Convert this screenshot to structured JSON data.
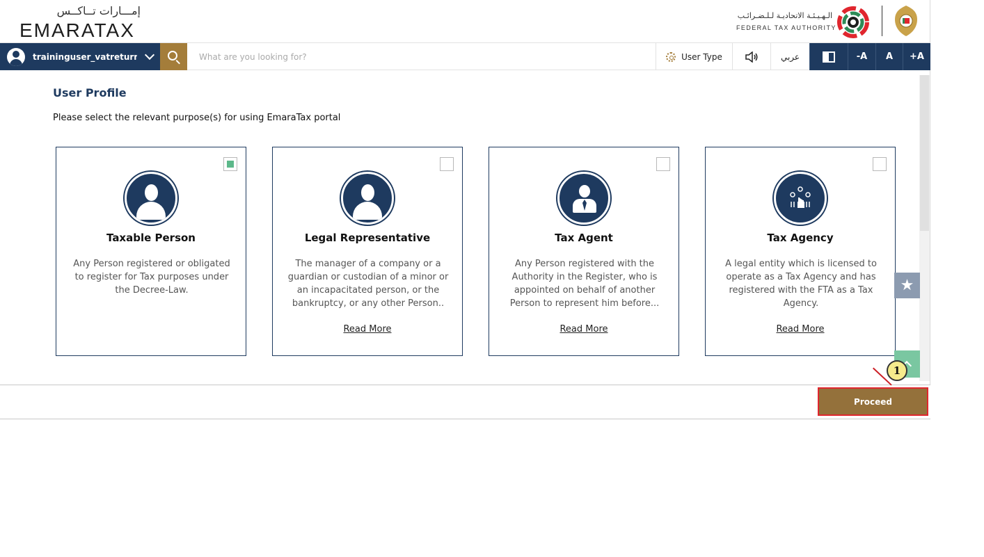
{
  "header": {
    "logo_ar": "إمـــارات تــاكــس",
    "logo_en": "EMARATAX",
    "fta_ar": "الـهـيـئـة الاتحاديـة لـلـضـرائـب",
    "fta_en": "FEDERAL TAX AUTHORITY",
    "logo_colors": [
      "#2e8b57",
      "#e0262e",
      "#1d1d1d"
    ]
  },
  "toolbar": {
    "user_name": "traininguser_vatreturns...",
    "search_placeholder": "What are you looking for?",
    "user_type_label": "User Type",
    "language_label": "عربي",
    "font_decrease": "-A",
    "font_normal": "A",
    "font_increase": "+A"
  },
  "main": {
    "title": "User Profile",
    "instruction": "Please select the relevant purpose(s) for using EmaraTax portal",
    "cards": [
      {
        "title": "Taxable Person",
        "description": "Any Person registered or obligated to register for Tax purposes under the Decree-Law.",
        "checked": true,
        "icon": "person-icon",
        "link": ""
      },
      {
        "title": "Legal Representative",
        "description": "The manager of a company or a guardian or custodian of a minor or an incapacitated person, or the bankruptcy, or any other Person..",
        "checked": false,
        "icon": "person-icon",
        "link": "Read More"
      },
      {
        "title": "Tax Agent",
        "description": "Any Person registered with the Authority in the Register, who is appointed on behalf of another Person to represent him before...",
        "checked": false,
        "icon": "agent-icon",
        "link": "Read More"
      },
      {
        "title": "Tax Agency",
        "description": "A legal entity which is licensed to operate as a Tax Agency and has registered with the FTA as a Tax Agency.",
        "checked": false,
        "icon": "agency-icon",
        "link": "Read More"
      }
    ]
  },
  "actions": {
    "proceed_label": "Proceed",
    "callout_number": "1",
    "favorite_glyph": "★"
  },
  "colors": {
    "navy": "#1e3a5f",
    "gold": "#a47d3a",
    "proceed": "#94713b",
    "checked": "#5cb88a",
    "highlight": "#e0262e"
  }
}
